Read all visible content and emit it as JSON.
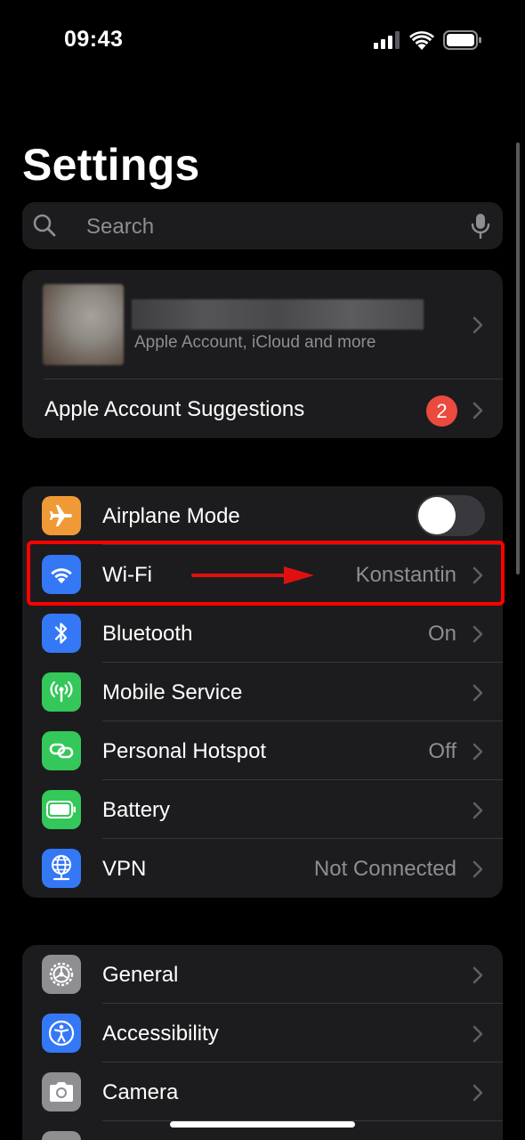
{
  "status": {
    "time": "09:43"
  },
  "title": "Settings",
  "search": {
    "placeholder": "Search"
  },
  "account": {
    "subtitle": "Apple Account, iCloud and more",
    "suggestions_label": "Apple Account Suggestions",
    "suggestions_badge": "2"
  },
  "connectivity": [
    {
      "label": "Airplane Mode",
      "icon": "airplane-icon",
      "color": "#f09a37",
      "toggle": false
    },
    {
      "label": "Wi-Fi",
      "value": "Konstantin",
      "icon": "wifi-icon",
      "color": "#3478f6"
    },
    {
      "label": "Bluetooth",
      "value": "On",
      "icon": "bluetooth-icon",
      "color": "#3478f6"
    },
    {
      "label": "Mobile Service",
      "value": "",
      "icon": "antenna-icon",
      "color": "#34c759"
    },
    {
      "label": "Personal Hotspot",
      "value": "Off",
      "icon": "hotspot-link-icon",
      "color": "#34c759"
    },
    {
      "label": "Battery",
      "value": "",
      "icon": "battery-icon",
      "color": "#34c759"
    },
    {
      "label": "VPN",
      "value": "Not Connected",
      "icon": "globe-icon",
      "color": "#3478f6"
    }
  ],
  "general_group": [
    {
      "label": "General",
      "icon": "gear-icon",
      "color": "#8e8e93"
    },
    {
      "label": "Accessibility",
      "icon": "accessibility-icon",
      "color": "#3478f6"
    },
    {
      "label": "Camera",
      "icon": "camera-icon",
      "color": "#8e8e93"
    },
    {
      "label": "",
      "icon": "generic-app-icon",
      "color": "#8e8e93"
    }
  ],
  "annotation": {
    "highlight_color": "#ff0000"
  }
}
